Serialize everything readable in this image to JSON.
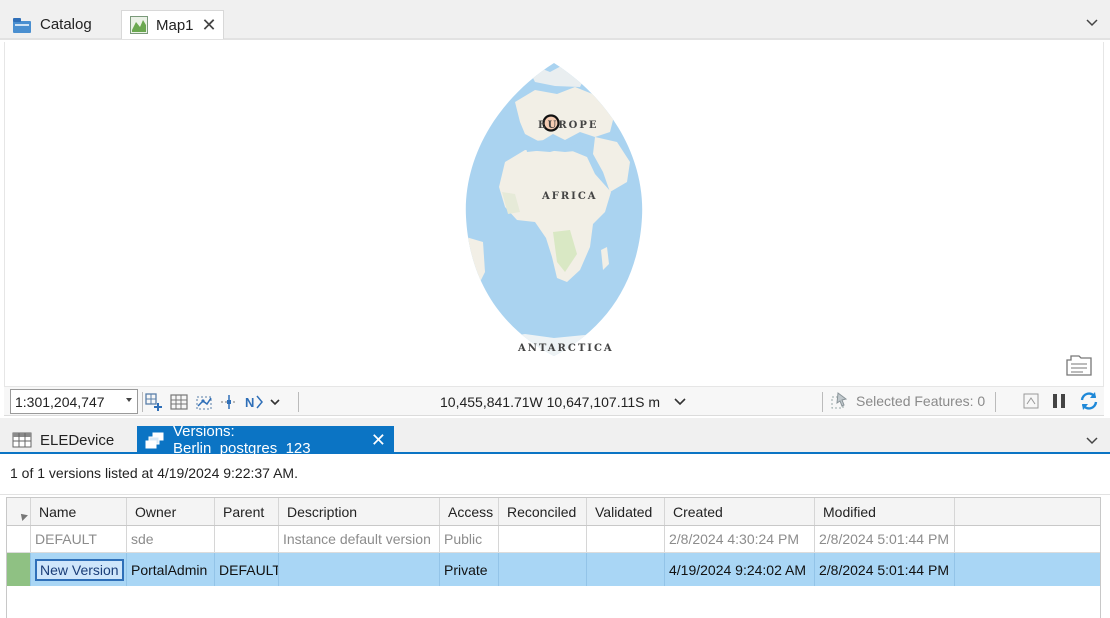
{
  "top_tabs": [
    {
      "label": "Catalog",
      "icon": "catalog-icon",
      "active": false
    },
    {
      "label": "Map1",
      "icon": "map-icon",
      "active": true
    }
  ],
  "map": {
    "labels": {
      "europe": "EUROPE",
      "africa": "AFRICA",
      "antarctica": "ANTARCTICA"
    },
    "ocean_color": "#aad3f0",
    "land_color": "#f2efe6"
  },
  "mapbar": {
    "scale": "1:301,204,747",
    "coordinates": "10,455,841.71W 10,647,107.11S m",
    "selected_features": "Selected Features: 0"
  },
  "bottom_tabs": [
    {
      "label": "ELEDevice",
      "icon": "table-icon",
      "active": false
    },
    {
      "label": "Versions: Berlin_postgres_123",
      "icon": "versions-icon",
      "active": true
    }
  ],
  "versions": {
    "status": "1 of 1 versions listed at 4/19/2024 9:22:37 AM.",
    "columns": [
      "Name",
      "Owner",
      "Parent",
      "Description",
      "Access",
      "Reconciled",
      "Validated",
      "Created",
      "Modified"
    ],
    "rows": [
      {
        "name": "DEFAULT",
        "owner": "sde",
        "parent": "",
        "description": "Instance default version",
        "access": "Public",
        "reconciled": "",
        "validated": "",
        "created": "2/8/2024 4:30:24 PM",
        "modified": "2/8/2024 5:01:44 PM"
      },
      {
        "name": "New Version",
        "owner": "PortalAdmin",
        "parent": "DEFAULT",
        "description": "",
        "access": "Private",
        "reconciled": "",
        "validated": "",
        "created": "4/19/2024 9:24:02 AM",
        "modified": "2/8/2024 5:01:44 PM"
      }
    ]
  },
  "colors": {
    "accent": "#0b74c4",
    "selected_row": "#a9d6f5",
    "edit_indicator": "#8fc183"
  }
}
